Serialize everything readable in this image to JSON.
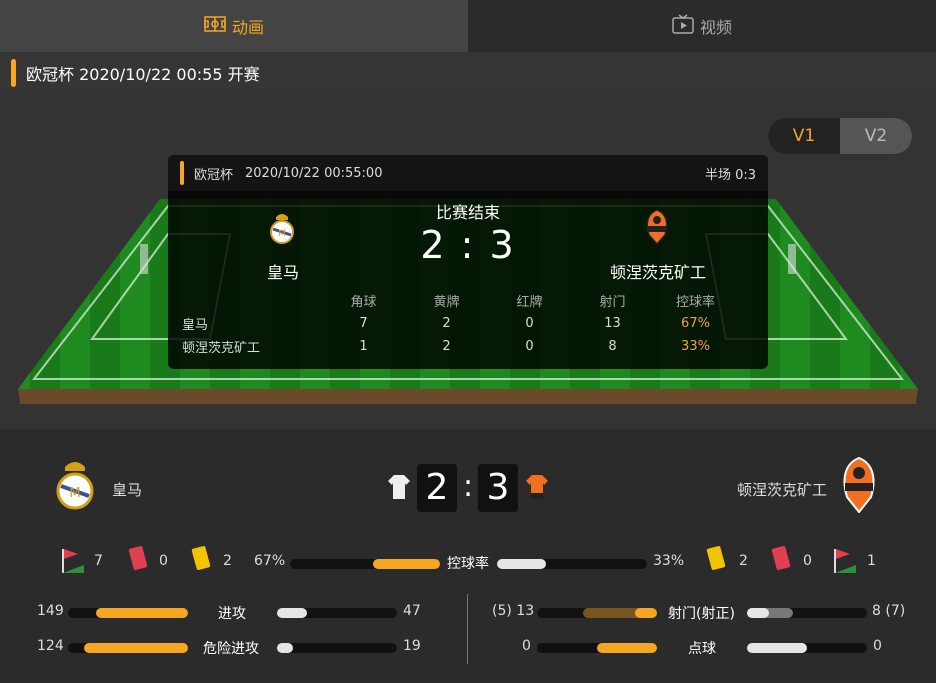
{
  "tabs": {
    "animation": "动画",
    "video": "视频"
  },
  "match_bar": {
    "text": "欧冠杯 2020/10/22 00:55 开赛"
  },
  "version_switch": {
    "v1": "V1",
    "v2": "V2"
  },
  "card": {
    "league": "欧冠杯",
    "datetime": "2020/10/22 00:55:00",
    "half": "半场 0:3",
    "status": "比赛结束",
    "score": "2 : 3",
    "home": "皇马",
    "away": "顿涅茨克矿工",
    "headers": [
      "角球",
      "黄牌",
      "红牌",
      "射门",
      "控球率"
    ],
    "rows": [
      {
        "team": "皇马",
        "values": [
          "7",
          "2",
          "0",
          "13",
          "67%"
        ]
      },
      {
        "team": "顿涅茨克矿工",
        "values": [
          "1",
          "2",
          "0",
          "8",
          "33%"
        ]
      }
    ]
  },
  "bottom": {
    "home_name": "皇马",
    "away_name": "顿涅茨克矿工",
    "home_score": "2",
    "away_score": "3",
    "colon": ":",
    "home_corners": "7",
    "home_red": "0",
    "home_yellow": "2",
    "away_yellow": "2",
    "away_red": "0",
    "away_corners": "1",
    "possession_home": "67%",
    "possession_away": "33%",
    "possession_label": "控球率",
    "possession_home_frac": 0.67,
    "attack_home": "149",
    "attack_away": "47",
    "attack_label": "进攻",
    "danger_home": "124",
    "danger_away": "19",
    "danger_label": "危险进攻",
    "shots_home": "(5) 13",
    "shots_away": "8 (7)",
    "shots_label": "射门(射正)",
    "pen_home": "0",
    "pen_away": "0",
    "pen_label": "点球"
  },
  "colors": {
    "accent": "#f5a623",
    "home_bar": "#f5a623",
    "away_bar": "#e6e6e6",
    "pitch": "#1f8f1f"
  }
}
